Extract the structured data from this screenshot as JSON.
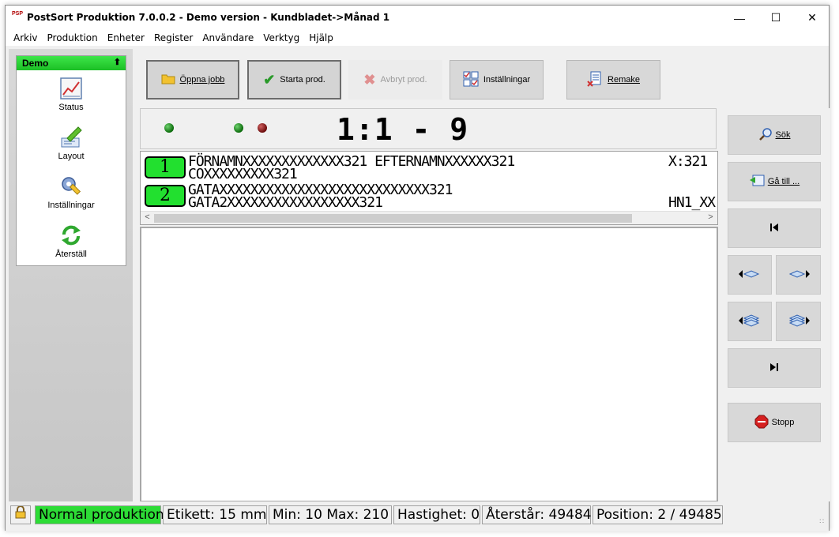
{
  "window": {
    "app_icon_text": "PSP",
    "title": "PostSort Produktion 7.0.0.2 - Demo version - Kundbladet->Månad 1",
    "controls": {
      "minimize": "—",
      "maximize": "☐",
      "close": "✕"
    }
  },
  "menu": [
    "Arkiv",
    "Produktion",
    "Enheter",
    "Register",
    "Användare",
    "Verktyg",
    "Hjälp"
  ],
  "sidebar": {
    "group_title": "Demo",
    "items": [
      {
        "label": "Status",
        "icon": "chart-icon"
      },
      {
        "label": "Layout",
        "icon": "layout-pen-icon"
      },
      {
        "label": "Inställningar",
        "icon": "settings-tools-icon"
      },
      {
        "label": "Återställ",
        "icon": "refresh-icon"
      }
    ]
  },
  "toolbar": {
    "open_job": "Öppna jobb",
    "start_prod": "Starta prod.",
    "abort_prod": "Avbryt prod.",
    "settings": "Inställningar",
    "remake": "Remake"
  },
  "info": {
    "counter": "1:1 - 9",
    "leds": [
      "green",
      "green",
      "red"
    ]
  },
  "records": [
    {
      "badge": "1",
      "line1": "FÖRNAMNXXXXXXXXXXXXX321 EFTERNAMNXXXXXX321",
      "line2": "COXXXXXXXXX321",
      "right": "X:321"
    },
    {
      "badge": "2",
      "line1": "GATAXXXXXXXXXXXXXXXXXXXXXXXXXXX321",
      "line2": "GATA2XXXXXXXXXXXXXXXXX321",
      "right": "HN1_XX"
    }
  ],
  "navigation": {
    "search": "Sök",
    "goto": "Gå till ...",
    "stop": "Stopp"
  },
  "status": {
    "mode": "Normal produktion",
    "label": "Etikett: 15 mm",
    "minmax": "Min: 10  Max: 210",
    "speed": "Hastighet: 0",
    "remaining": "Återstår: 49484",
    "position": "Position: 2 / 49485"
  },
  "colors": {
    "accent_green": "#22e02f",
    "led_green": "#0a6a0a",
    "led_red": "#6a0a0a"
  }
}
